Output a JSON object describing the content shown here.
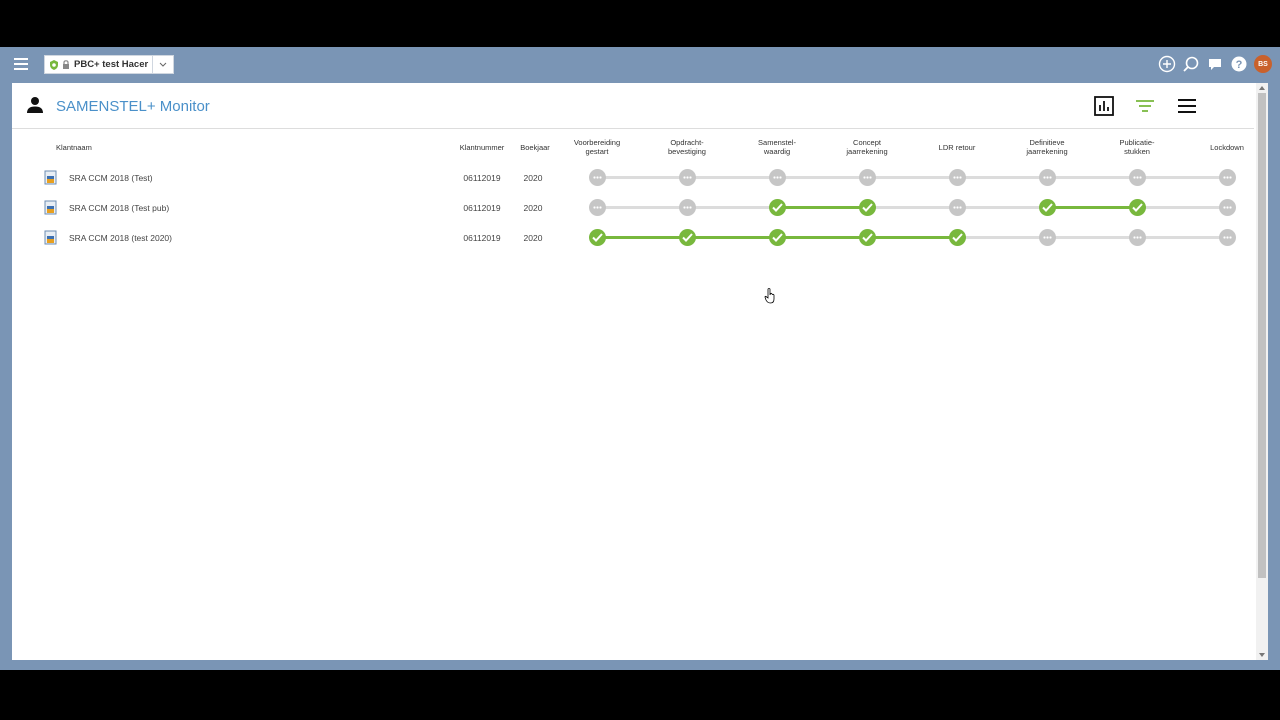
{
  "app": {
    "environment_label": "PBC+ test Hacer",
    "avatar_initials": "BS"
  },
  "page": {
    "title": "SAMENSTEL+ Monitor"
  },
  "colors": {
    "accent": "#4a90c9",
    "done": "#78b83d",
    "pending": "#c6c6c6",
    "avatar": "#c9612c",
    "topbar": "#7a95b5"
  },
  "table": {
    "headers": {
      "name": "Klantnaam",
      "number": "Klantnummer",
      "year": "Boekjaar"
    },
    "stages": [
      [
        "Voorbereiding",
        "gestart"
      ],
      [
        "Opdracht-",
        "bevestiging"
      ],
      [
        "Samenstel-",
        "waardig"
      ],
      [
        "Concept",
        "jaarrekening"
      ],
      [
        "LDR retour",
        ""
      ],
      [
        "Definitieve",
        "jaarrekening"
      ],
      [
        "Publicatie-",
        "stukken"
      ],
      [
        "Lockdown",
        ""
      ]
    ],
    "rows": [
      {
        "name": "SRA CCM 2018 (Test)",
        "number": "06112019",
        "year": "2020",
        "status": [
          0,
          0,
          0,
          0,
          0,
          0,
          0,
          0
        ]
      },
      {
        "name": "SRA CCM 2018 (Test pub)",
        "number": "06112019",
        "year": "2020",
        "status": [
          0,
          0,
          1,
          1,
          0,
          1,
          1,
          0
        ]
      },
      {
        "name": "SRA CCM 2018 (test 2020)",
        "number": "06112019",
        "year": "2020",
        "status": [
          1,
          1,
          1,
          1,
          1,
          0,
          0,
          0
        ]
      }
    ]
  }
}
